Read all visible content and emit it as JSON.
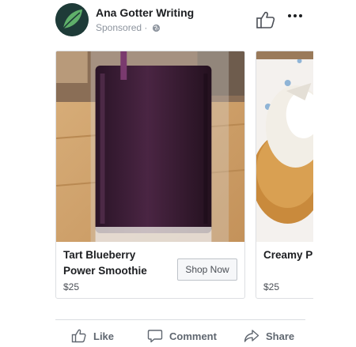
{
  "post": {
    "page_name": "Ana Gotter Writing",
    "sponsored": "Sponsored · "
  },
  "cards": [
    {
      "title": "Tart Blueberry\nPower Smoothie",
      "price": "$25",
      "cta": "Shop Now"
    },
    {
      "title": "Creamy P\nCheeseca",
      "price": "$25"
    }
  ],
  "actions": {
    "like": "Like",
    "comment": "Comment",
    "share": "Share"
  },
  "icons": [
    "logo-icon",
    "globe-icon",
    "thumbs-up-icon",
    "more-icon",
    "comment-icon",
    "share-icon"
  ],
  "colors": {
    "avatar_bg": "#1e3b38",
    "leaf": "#5fb06a",
    "text_secondary": "#606770"
  }
}
